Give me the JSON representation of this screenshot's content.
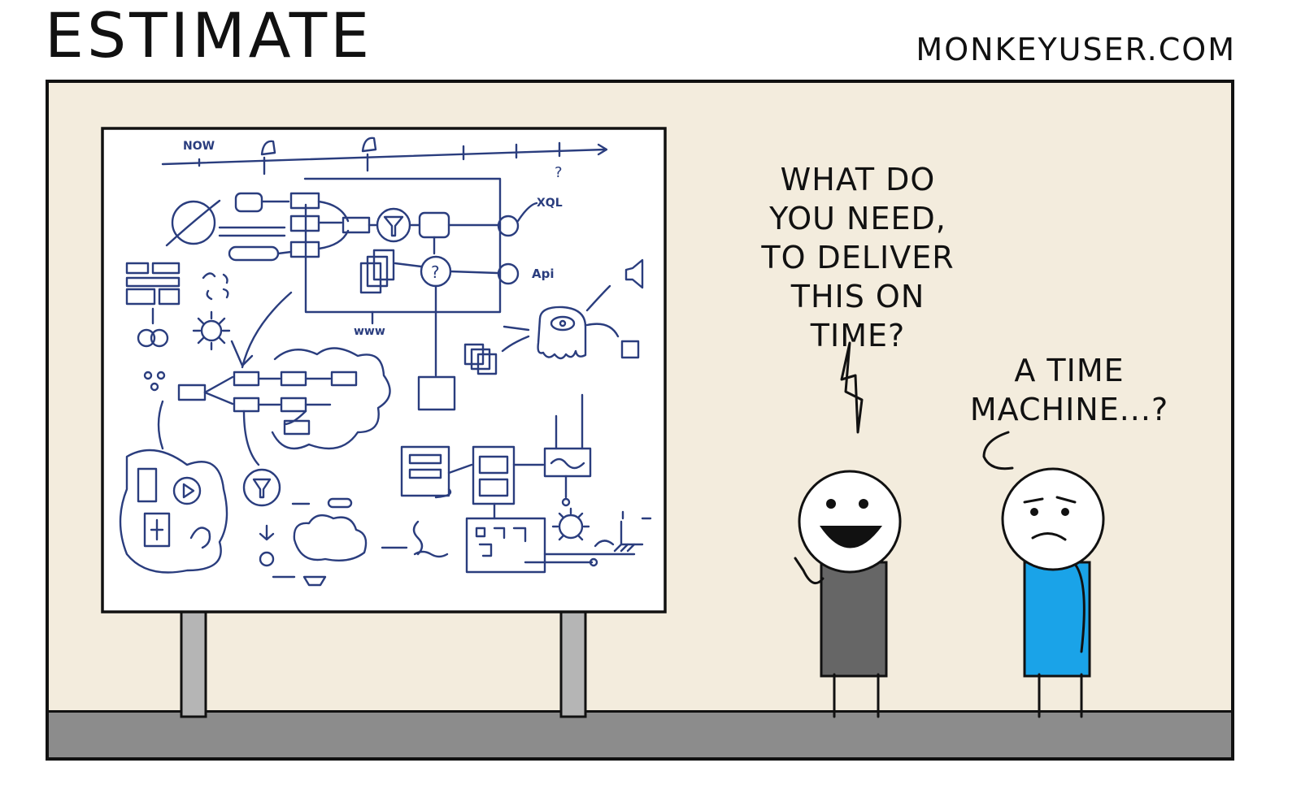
{
  "comic": {
    "title": "ESTIMATE",
    "site": "MONKEYUSER.COM",
    "colors": {
      "wall": "#f3ecdd",
      "ground": "#8c8c8c",
      "diagram_ink": "#2a3d7e",
      "shirt_speaker": "#666666",
      "shirt_listener": "#1aa3e8"
    },
    "whiteboard": {
      "labels": {
        "now": "NOW",
        "query": "XQL",
        "api": "Api",
        "web": "www",
        "timeline_question": "?"
      }
    },
    "speech": {
      "speaker_line": "WHAT DO YOU NEED, TO DELIVER THIS ON TIME?",
      "reply_line": "A TIME MACHINE...?"
    }
  }
}
